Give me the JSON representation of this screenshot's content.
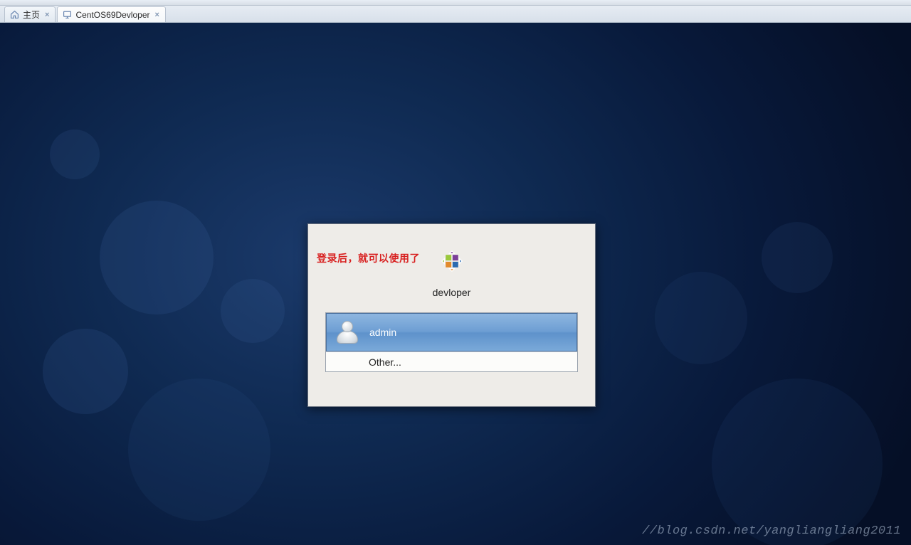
{
  "tabs": {
    "home": {
      "label": "主页"
    },
    "vm": {
      "label": "CentOS69Devloper"
    }
  },
  "annotation": {
    "text": "登录后，就可以使用了"
  },
  "login": {
    "hostname": "devloper",
    "users": {
      "admin": {
        "label": "admin"
      },
      "other": {
        "label": "Other..."
      }
    }
  },
  "watermark": {
    "text": "//blog.csdn.net/yangliangliang2011"
  },
  "colors": {
    "accent": "#6d9ed3",
    "annotation": "#d82020"
  }
}
